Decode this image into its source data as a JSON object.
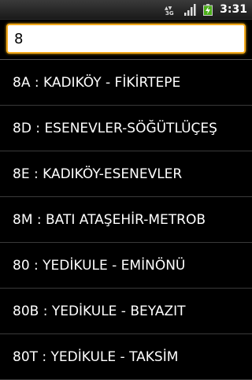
{
  "status_bar": {
    "network_icon": "3g-network-icon",
    "signal_icon": "signal-strength-icon",
    "battery_icon": "battery-charging-icon",
    "time": "3:31"
  },
  "search": {
    "value": "8",
    "accent_color": "#f2a91c"
  },
  "routes": [
    {
      "label": "8A : KADIKÖY - FİKİRTEPE"
    },
    {
      "label": "8D : ESENEVLER-SÖĞÜTLÜÇEŞ"
    },
    {
      "label": "8E : KADIKÖY-ESENEVLER"
    },
    {
      "label": "8M : BATI ATAŞEHİR-METROB"
    },
    {
      "label": "80 : YEDİKULE - EMİNÖNÜ"
    },
    {
      "label": "80B : YEDİKULE - BEYAZIT"
    },
    {
      "label": "80T : YEDİKULE - TAKSİM"
    }
  ]
}
